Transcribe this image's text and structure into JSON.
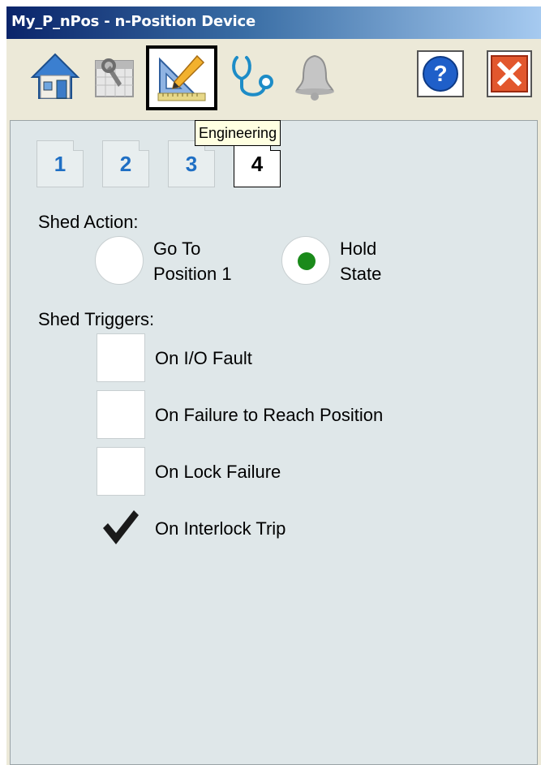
{
  "window": {
    "title": "My_P_nPos - n-Position Device"
  },
  "toolbar": {
    "buttons": [
      {
        "name": "home",
        "icon": "home-icon"
      },
      {
        "name": "maintenance",
        "icon": "maintenance-calendar-icon"
      },
      {
        "name": "engineering",
        "icon": "engineering-icon",
        "active": true
      },
      {
        "name": "diagnostics",
        "icon": "stethoscope-icon"
      },
      {
        "name": "alarms",
        "icon": "bell-icon"
      },
      {
        "name": "help",
        "icon": "help-icon"
      },
      {
        "name": "close",
        "icon": "close-icon"
      }
    ],
    "tooltip": "Engineering"
  },
  "pages": {
    "tabs": [
      "1",
      "2",
      "3",
      "4"
    ],
    "active": "4"
  },
  "shed_action": {
    "label": "Shed Action:",
    "options": [
      {
        "line1": "Go To",
        "line2": "Position 1",
        "selected": false
      },
      {
        "line1": "Hold",
        "line2": "State",
        "selected": true
      }
    ]
  },
  "shed_triggers": {
    "label": "Shed Triggers:",
    "items": [
      {
        "label": "On I/O Fault",
        "checked": false
      },
      {
        "label": "On Failure to Reach Position",
        "checked": false
      },
      {
        "label": "On Lock Failure",
        "checked": false
      },
      {
        "label": "On Interlock Trip",
        "checked": true
      }
    ]
  },
  "colors": {
    "selected_radio": "#1a8a1a",
    "tab_number": "#1f6fc4",
    "panel_bg": "#dfe7e9"
  }
}
